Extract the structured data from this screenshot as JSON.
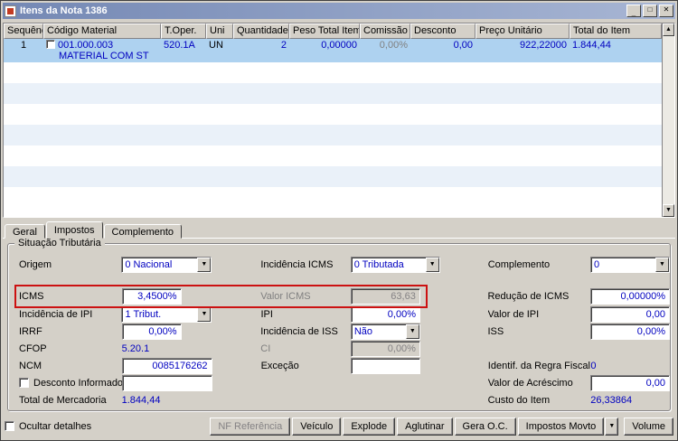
{
  "window": {
    "title": "Itens da Nota 1386"
  },
  "icons": {
    "minimize": "_",
    "maximize": "□",
    "close": "✕",
    "dropdown_arrow": "▼",
    "scroll_up": "▲",
    "scroll_down": "▼"
  },
  "grid": {
    "columns": [
      "Sequência",
      "Código Material",
      "T.Oper.",
      "Uni",
      "Quantidade",
      "Peso Total Item",
      "Comissão",
      "Desconto",
      "Preço Unitário",
      "Total do Item"
    ],
    "row": {
      "sequencia": "1",
      "codigo_material": "001.000.003",
      "descricao": "MATERIAL COM ST",
      "t_oper": "520.1A",
      "uni": "UN",
      "quantidade": "2",
      "peso_total_item": "0,00000",
      "comissao": "0,00%",
      "desconto": "0,00",
      "preco_unitario": "922,22000",
      "total_do_item": "1.844,44"
    }
  },
  "tabs": {
    "geral": "Geral",
    "impostos": "Impostos",
    "complemento": "Complemento"
  },
  "form": {
    "group_title": "Situação Tributária",
    "origem": {
      "label": "Origem",
      "value": "0 Nacional"
    },
    "incidencia_icms": {
      "label": "Incidência ICMS",
      "value": "0 Tributada"
    },
    "complemento": {
      "label": "Complemento",
      "value": "0"
    },
    "icms": {
      "label": "ICMS",
      "value": "3,4500%"
    },
    "valor_icms": {
      "label": "Valor ICMS",
      "value": "63,63"
    },
    "reducao_icms": {
      "label": "Redução de ICMS",
      "value": "0,00000%"
    },
    "incidencia_ipi": {
      "label": "Incidência de IPI",
      "value": "1 Tribut."
    },
    "ipi": {
      "label": "IPI",
      "value": "0,00%"
    },
    "valor_ipi": {
      "label": "Valor de IPI",
      "value": "0,00"
    },
    "irrf": {
      "label": "IRRF",
      "value": "0,00%"
    },
    "incidencia_iss": {
      "label": "Incidência de ISS",
      "value": "Não"
    },
    "iss": {
      "label": "ISS",
      "value": "0,00%"
    },
    "cfop": {
      "label": "CFOP",
      "value": "5.20.1"
    },
    "ci": {
      "label": "CI",
      "value": "0,00%"
    },
    "ncm": {
      "label": "NCM",
      "value": "0085176262"
    },
    "excecao": {
      "label": "Exceção",
      "value": ""
    },
    "identif_regra_fiscal": {
      "label": "Identif. da Regra Fiscal",
      "value": "0"
    },
    "desconto_informado": {
      "label": "Desconto Informado",
      "value": ""
    },
    "valor_acrescimo": {
      "label": "Valor de Acréscimo",
      "value": "0,00"
    },
    "total_mercadoria": {
      "label": "Total de Mercadoria",
      "value": "1.844,44"
    },
    "custo_item": {
      "label": "Custo do Item",
      "value": "26,33864"
    }
  },
  "footer": {
    "ocultar_detalhes": "Ocultar detalhes",
    "nf_referencia": "NF Referência",
    "veiculo": "Veículo",
    "explode": "Explode",
    "aglutinar": "Aglutinar",
    "gera_oc": "Gera O.C.",
    "impostos_movto": "Impostos Movto",
    "volume": "Volume"
  },
  "colors": {
    "highlight_box": "#CC1111",
    "selected_row": "#AED2F0",
    "value_text": "#0000C0",
    "titlebar": "#7488B4",
    "panel": "#D4D0C8"
  }
}
